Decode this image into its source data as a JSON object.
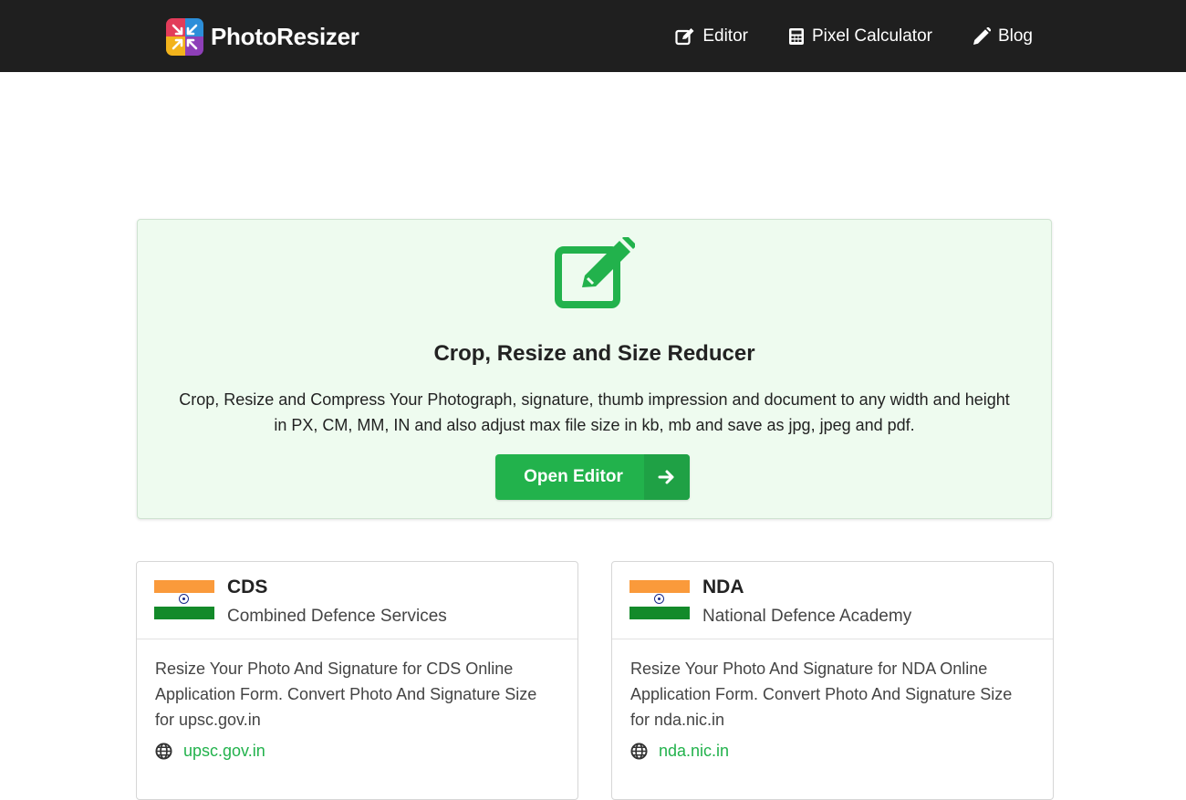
{
  "navbar": {
    "brand": "PhotoResizer",
    "links": [
      {
        "label": "Editor",
        "icon": "edit-icon"
      },
      {
        "label": "Pixel Calculator",
        "icon": "calculator-icon"
      },
      {
        "label": "Blog",
        "icon": "pencil-icon"
      }
    ],
    "background": "#1f1f1f"
  },
  "hero": {
    "icon": "edit-square-icon",
    "title": "Crop, Resize and Size Reducer",
    "description_line1": "Crop, Resize and Compress Your Photograph, signature, thumb impression and document to any width and height",
    "description_line2": "in PX, CM, MM, IN and also adjust max file size in kb, mb and save as jpg, jpeg and pdf.",
    "button_label": "Open Editor",
    "background": "#eefbef",
    "accent": "#22b24c"
  },
  "exams": [
    {
      "code": "CDS",
      "name": "Combined Defence Services",
      "description": "Resize Your Photo And Signature for CDS Online Application Form. Convert Photo And Signature Size for upsc.gov.in",
      "website": "upsc.gov.in",
      "flag": "india-flag-icon"
    },
    {
      "code": "NDA",
      "name": "National Defence Academy",
      "description": "Resize Your Photo And Signature for NDA Online Application Form. Convert Photo And Signature Size for nda.nic.in",
      "website": "nda.nic.in",
      "flag": "india-flag-icon"
    }
  ]
}
